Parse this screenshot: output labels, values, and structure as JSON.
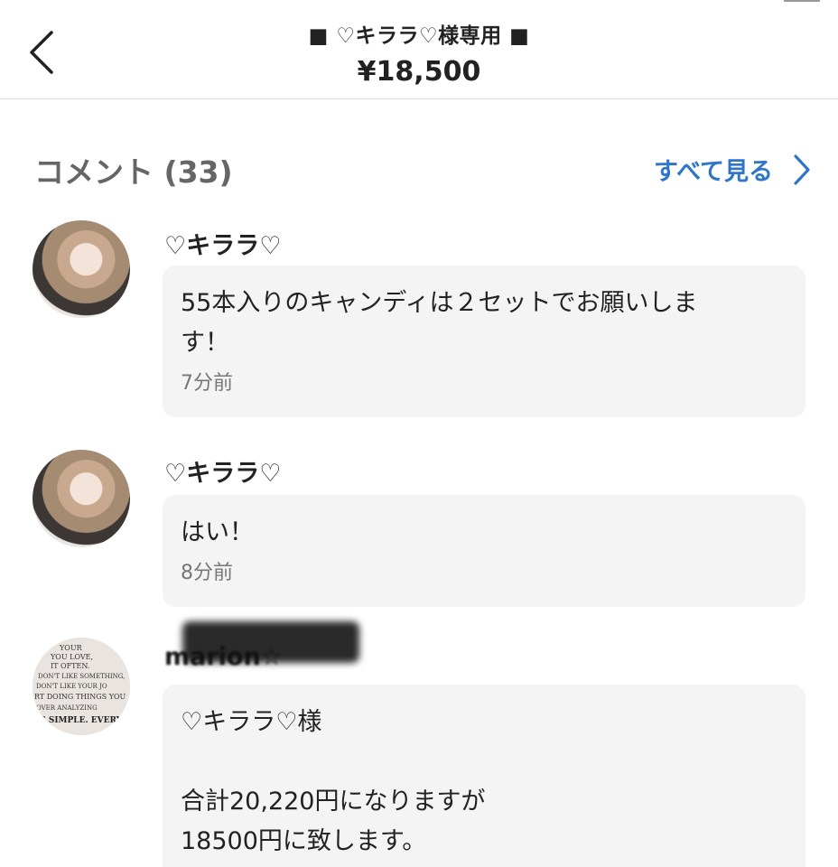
{
  "header": {
    "title": "■ ♡キララ♡様専用 ■",
    "price": "¥18,500"
  },
  "comments_section": {
    "title": "コメント (33)",
    "see_all_label": "すべて見る"
  },
  "comments": [
    {
      "username": "♡キララ♡",
      "body": "55本入りのキャンディは２セットでお願いしま\nす！",
      "time": "7分前"
    },
    {
      "username": "♡キララ♡",
      "body": "はい！",
      "time": "8分前"
    },
    {
      "username": "marion☆",
      "body": "♡キララ♡様\n\n合計20,220円になりますが\n18500円に致します。"
    }
  ],
  "avatar_3_words": [
    "YOUR",
    "YOU LOVE,",
    "IT OFTEN.",
    "DON'T LIKE SOMETHING,",
    "DON'T LIKE YOUR JO",
    "RT DOING THINGS YOU",
    "OVER ANALYZING",
    "IS SIMPLE. EVERY"
  ],
  "colors": {
    "link": "#2f76c8",
    "bubble": "#f4f4f4",
    "divider": "#dcdcdc"
  },
  "icons": {
    "back": "chevron-left-icon",
    "see_all": "chevron-right-icon"
  }
}
